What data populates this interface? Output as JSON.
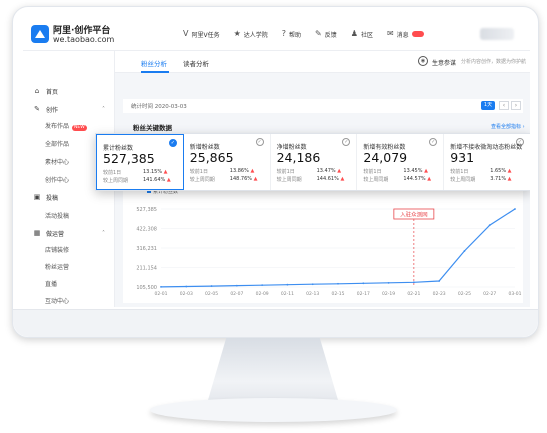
{
  "header": {
    "logo_title": "阿里·创作平台",
    "logo_sub": "we.taobao.com",
    "nav": [
      {
        "icon": "vip-icon",
        "glyph": "V",
        "label": "阿里V任务"
      },
      {
        "icon": "star-icon",
        "glyph": "★",
        "label": "达人学院"
      },
      {
        "icon": "help-circle-icon",
        "glyph": "?",
        "label": "帮助"
      },
      {
        "icon": "feedback-icon",
        "glyph": "✎",
        "label": "反馈"
      },
      {
        "icon": "community-icon",
        "glyph": "♟",
        "label": "社区"
      },
      {
        "icon": "mail-icon",
        "glyph": "✉",
        "label": "消息"
      }
    ]
  },
  "sidebar": {
    "items": [
      {
        "icon": "home-icon",
        "glyph": "⌂",
        "label": "首页"
      },
      {
        "icon": "create-icon",
        "glyph": "✎",
        "label": "创作"
      },
      {
        "icon": "submit-icon",
        "glyph": "▣",
        "label": "投稿"
      },
      {
        "icon": "operate-icon",
        "glyph": "▦",
        "label": "做运营"
      }
    ],
    "create_children": [
      "发布作品",
      "全部作品",
      "素材中心",
      "创作中心"
    ],
    "new_badge": "NEW",
    "submit_children": [
      "活动投稿"
    ],
    "operate_children": [
      "店铺装修",
      "粉丝运营",
      "直播",
      "互动中心"
    ]
  },
  "tabs": {
    "items": [
      "粉丝分析",
      "读者分析"
    ],
    "help_label": "生意参谋",
    "help_desc": "分析内容创作，数据为你护航"
  },
  "date_bar": {
    "text": "统计时间 2020-03-03",
    "range": "1天",
    "prev": "‹",
    "next": "›"
  },
  "section": {
    "title": "粉丝关键数据",
    "link": "查看全部指标 ›"
  },
  "metrics": [
    {
      "label": "累计粉丝数",
      "value": "527,385",
      "day_label": "较前1日",
      "day_val": "13.15%",
      "week_label": "较上周同期",
      "week_val": "141.64%",
      "selected": true
    },
    {
      "label": "新增粉丝数",
      "value": "25,865",
      "day_label": "较前1日",
      "day_val": "13.86%",
      "week_label": "较上周同期",
      "week_val": "148.76%",
      "selected": false
    },
    {
      "label": "净增粉丝数",
      "value": "24,186",
      "day_label": "较前1日",
      "day_val": "13.47%",
      "week_label": "较上周同期",
      "week_val": "144.61%",
      "selected": false
    },
    {
      "label": "新增有效粉丝数",
      "value": "24,079",
      "day_label": "较前1日",
      "day_val": "13.45%",
      "week_label": "较上周同期",
      "week_val": "144.57%",
      "selected": false
    },
    {
      "label": "新增不接收微淘动态粉丝数",
      "value": "931",
      "day_label": "较前1日",
      "day_val": "1.65%",
      "week_label": "较上周同期",
      "week_val": "3.71%",
      "selected": false
    }
  ],
  "colors": {
    "accent": "#1a7cf0",
    "up": "#ff4d4f",
    "line": "#3d8ef0",
    "marker": "#e8474c"
  },
  "chart_data": {
    "type": "line",
    "legend": "累计粉丝数",
    "annotation": "入驻众测网",
    "annotation_x": "02-21",
    "x": [
      "02-01",
      "02-03",
      "02-05",
      "02-07",
      "02-09",
      "02-11",
      "02-13",
      "02-15",
      "02-17",
      "02-19",
      "02-21",
      "02-23",
      "02-25",
      "02-27",
      "03-01"
    ],
    "y_ticks": [
      "527,385",
      "422,308",
      "316,231",
      "211,154",
      "105,500"
    ],
    "ylim": [
      105500,
      527385
    ],
    "series": [
      {
        "values": [
          106000,
          108000,
          110500,
          113000,
          115500,
          118000,
          120500,
          123000,
          125500,
          128000,
          131000,
          138000,
          300000,
          440000,
          527385
        ]
      }
    ]
  }
}
